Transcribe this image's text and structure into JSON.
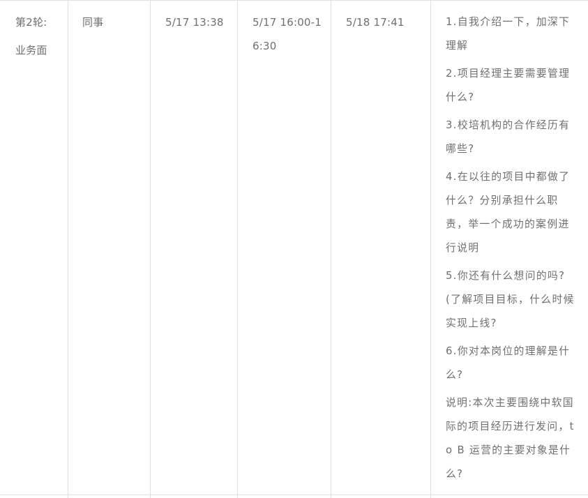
{
  "table": {
    "row": {
      "round": "第2轮:",
      "round_type": "业务面",
      "interviewer": "同事",
      "applied_time": "5/17 13:38",
      "interview_time": "5/17  16:00-16:30",
      "result_time": "5/18 17:41",
      "questions": [
        "1.自我介绍一下，加深下理解",
        "2.项目经理主要需要管理什么?",
        "3.校培机构的合作经历有哪些?",
        "4.在以往的项目中都做了什么？分别承担什么职责，举一个成功的案例进行说明",
        "5.你还有什么想问的吗?(了解项目目标，什么时候实现上线?",
        "6.你对本岗位的理解是什么?",
        "说明:本次主要围绕中软国际的项目经历进行发问，to B 运营的主要对象是什么?"
      ]
    }
  }
}
